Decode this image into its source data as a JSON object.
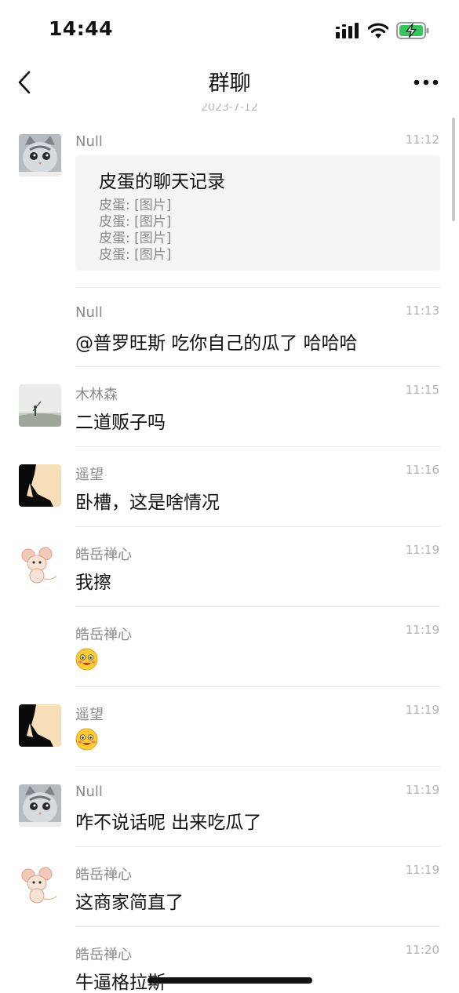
{
  "status_bar": {
    "time": "14:44",
    "signal_icon": "signal-bars-icon",
    "wifi_icon": "wifi-icon",
    "battery_icon": "battery-charging-icon",
    "battery_color": "#34c759"
  },
  "nav": {
    "title": "群聊",
    "back_icon": "chevron-left-icon",
    "more_icon": "more-dots-icon"
  },
  "date_separator": "2023-7-12",
  "messages": [
    {
      "sender": "Null",
      "time": "11:12",
      "avatar": "cat-avatar",
      "chat_record": {
        "title": "皮蛋的聊天记录",
        "lines": [
          "皮蛋: [图片]",
          "皮蛋: [图片]",
          "皮蛋: [图片]",
          "皮蛋: [图片]"
        ]
      }
    },
    {
      "sender": "Null",
      "time": "11:13",
      "text": "@普罗旺斯 吃你自己的瓜了 哈哈哈"
    },
    {
      "sender": "木林森",
      "time": "11:15",
      "avatar": "landscape-avatar",
      "text": "二道贩子吗"
    },
    {
      "sender": "遥望",
      "time": "11:16",
      "avatar": "silhouette-avatar",
      "text": "卧槽，这是啥情况"
    },
    {
      "sender": "皓岳禅心",
      "time": "11:19",
      "avatar": "cartoon-mouse-avatar",
      "text": "我擦"
    },
    {
      "sender": "皓岳禅心",
      "time": "11:19",
      "emoji": "smiling-face-emoji"
    },
    {
      "sender": "遥望",
      "time": "11:19",
      "avatar": "silhouette-avatar",
      "emoji": "smiling-face-emoji"
    },
    {
      "sender": "Null",
      "time": "11:19",
      "avatar": "cat-avatar",
      "text": "咋不说话呢  出来吃瓜了"
    },
    {
      "sender": "皓岳禅心",
      "time": "11:19",
      "avatar": "cartoon-mouse-avatar",
      "text": "这商家简直了"
    },
    {
      "sender": "皓岳禅心",
      "time": "11:20",
      "text": "牛逼格拉斯"
    }
  ]
}
